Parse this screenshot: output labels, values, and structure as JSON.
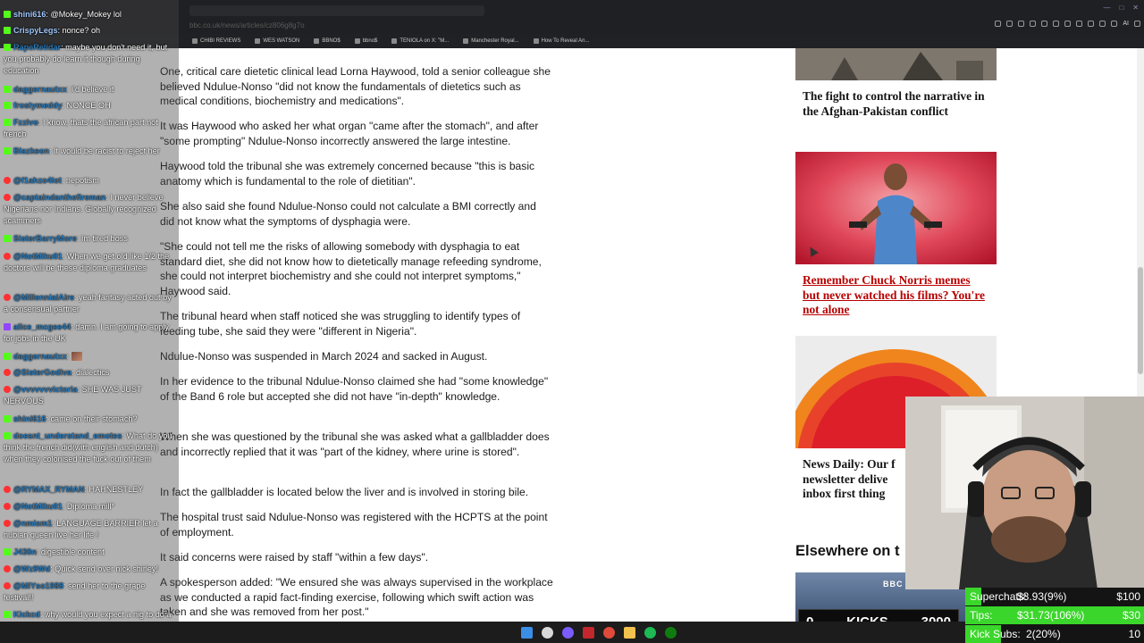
{
  "browser": {
    "url_fragment": "bbc.co.uk/news/articles/cz806g8g7o",
    "bookmarks": [
      "CHIBI REVIEWS",
      "WES WATSON",
      "BBNO$",
      "bbno$",
      "TENIOLA on X: \"M...",
      "Manchester Royal...",
      "How To Reveal An..."
    ],
    "ai_label": "AI"
  },
  "article": {
    "paragraphs": [
      "One, critical care dietetic clinical lead Lorna Haywood, told a senior colleague she believed Ndulue-Nonso \"did not know the fundamentals of dietetics such as medical conditions, biochemistry and medications\".",
      "It was Haywood who asked her what organ \"came after the stomach\", and after \"some prompting\" Ndulue-Nonso incorrectly answered the large intestine.",
      "Haywood told the tribunal she was extremely concerned because \"this is basic anatomy which is fundamental to the role of dietitian\".",
      "She also said she found Ndulue-Nonso could not calculate a BMI correctly and did not know what the symptoms of dysphagia were.",
      "\"She could not tell me the risks of allowing somebody with dysphagia to eat standard diet, she did not know how to dietetically manage refeeding syndrome, she could not interpret biochemistry and she could not interpret symptoms,\" Haywood said.",
      "The tribunal heard when staff noticed she was struggling to identify types of feeding tube, she said they were \"different in Nigeria\".",
      "Ndulue-Nonso was suspended in March 2024 and sacked in August.",
      "In her evidence to the tribunal Ndulue-Nonso claimed she had \"some knowledge\" of the Band 6 role but accepted she did not have \"in-depth\" knowledge.",
      "When she was questioned by the tribunal she was asked what a gallbladder does and incorrectly replied that it was \"part of the kidney, where urine is stored\".",
      "In fact the gallbladder is located below the liver and is involved in storing bile.",
      "The hospital trust said Ndulue-Nonso was registered with the HCPTS at the point of employment.",
      "It said concerns were raised by staff \"within a few days\".",
      "A spokesperson added: \"We ensured she was always supervised in the workplace as we conducted a rapid fact-finding exercise, following which swift action was taken and she was removed from her post.\""
    ]
  },
  "sidebar": {
    "card1_title": "The fight to control the narrative in the Afghan-Pakistan conflict",
    "card2_title": "Remember Chuck Norris memes but never watched his films? You're not alone",
    "card3_title": "News Daily: Our f newsletter delive inbox first thing",
    "elsewhere_heading": "Elsewhere on t",
    "bbc_logo": "BBC"
  },
  "chat": {
    "messages": [
      {
        "platform": "kick",
        "user": "shini616",
        "text": "@Mokey_Mokey lol"
      },
      {
        "platform": "kick",
        "user": "CrispyLegs",
        "text": "nonce? oh"
      },
      {
        "platform": "kick",
        "user": "RapeRelidar",
        "text": "maybe you don't need it, but you probably do learn it though during education"
      },
      {
        "platform": "kick",
        "user": "daggernautxx",
        "text": "I'd believe it"
      },
      {
        "platform": "kick",
        "user": "frostymeddy",
        "text": "NONCE OH"
      },
      {
        "platform": "kick",
        "user": "Fzzivo",
        "text": "I know, thats the african part not french"
      },
      {
        "platform": "kick",
        "user": "Blazkeon",
        "text": "It would be racist to reject her"
      },
      {
        "platform": "yt",
        "user": "@f1ahzo4lot",
        "text": "nepotism"
      },
      {
        "platform": "yt",
        "user": "@captaindanthefireman",
        "text": "I never believe Nigerians nor Indians. Globally recognized scammers"
      },
      {
        "platform": "kick",
        "user": "SisterBarryMore",
        "text": "Im tired boss"
      },
      {
        "platform": "yt",
        "user": "@NotMiku01",
        "text": "When we get old like 1/2 the doctors will be these diploma graduates"
      },
      {
        "platform": "yt",
        "user": "@MillennialAire",
        "text": "yeah fantasy acted out by a consensual partner"
      },
      {
        "platform": "tw",
        "user": "alice_mcgee44",
        "text": "damn. I am going to apply for jobs in the UK"
      },
      {
        "platform": "kick",
        "user": "daggernautxx",
        "text": ""
      },
      {
        "platform": "yt",
        "user": "@SisterGodiva",
        "text": "dialectics"
      },
      {
        "platform": "yt",
        "user": "@vvvvvvvictoria",
        "text": "SHE WAS JUST NERVOUS"
      },
      {
        "platform": "kick",
        "user": "shini616",
        "text": "came on their stomach?"
      },
      {
        "platform": "kick",
        "user": "doesnt_understand_emotes",
        "text": "What do you think the french did(with english and dutch) when they colonised the fuck out of them"
      },
      {
        "platform": "yt",
        "user": "@RYMAX_RYMAN",
        "text": "HAHNESTLEY"
      },
      {
        "platform": "yt",
        "user": "@NotMiku01",
        "text": "Diploma mill*"
      },
      {
        "platform": "yt",
        "user": "@nmism1",
        "text": "LANGUAGE BARRIER let a nubian queen live her life !"
      },
      {
        "platform": "kick",
        "user": "J430n",
        "text": "digestible content"
      },
      {
        "platform": "yt",
        "user": "@Wz9Wd",
        "text": "Quick send over nick shirley!"
      },
      {
        "platform": "yt",
        "user": "@MlYso1988",
        "text": "send her to the grape festival!!"
      },
      {
        "platform": "kick",
        "user": "Kickcd",
        "text": "why would you expect a nig to do a good job"
      }
    ]
  },
  "stream": {
    "kicks_left": "0",
    "kicks_label": "KICKS",
    "kicks_right": "3000",
    "superchats_label": "Superchats:",
    "superchats_value": "$8.93(9%)",
    "superchats_goal": "$100",
    "superchats_progress": 0.09,
    "tips_label": "Tips:",
    "tips_value": "$31.73(106%)",
    "tips_goal": "$30",
    "tips_progress": 1.0,
    "kicksubs_label": "Kick Subs:",
    "kicksubs_value": "2(20%)",
    "kicksubs_goal": "10",
    "kicksubs_progress": 0.2
  },
  "colors": {
    "kick_green": "#53fc18",
    "youtube_red": "#ff3030",
    "bbc_link_red": "#b80000",
    "progress_green": "#3bd62b"
  }
}
